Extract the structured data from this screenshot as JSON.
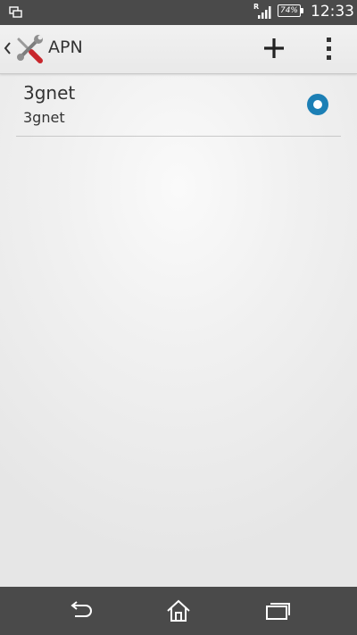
{
  "status_bar": {
    "roaming_indicator": "R",
    "battery_percent": "74%",
    "battery_level": 0.74,
    "time": "12:33",
    "icons": [
      "screen-mirror-icon",
      "signal-icon",
      "battery-icon"
    ]
  },
  "action_bar": {
    "title": "APN",
    "icons": [
      "back-chevron-icon",
      "settings-tools-icon",
      "add-icon",
      "overflow-menu-icon"
    ]
  },
  "apn_list": [
    {
      "name": "3gnet",
      "apn": "3gnet",
      "selected": true
    }
  ],
  "nav_bar": {
    "icons": [
      "back-icon",
      "home-icon",
      "recent-apps-icon"
    ]
  },
  "colors": {
    "status_bar": "#4a4a4a",
    "nav_bar": "#4a4a4a",
    "radio_accent": "#1c7fb5",
    "text_primary": "#333333"
  }
}
